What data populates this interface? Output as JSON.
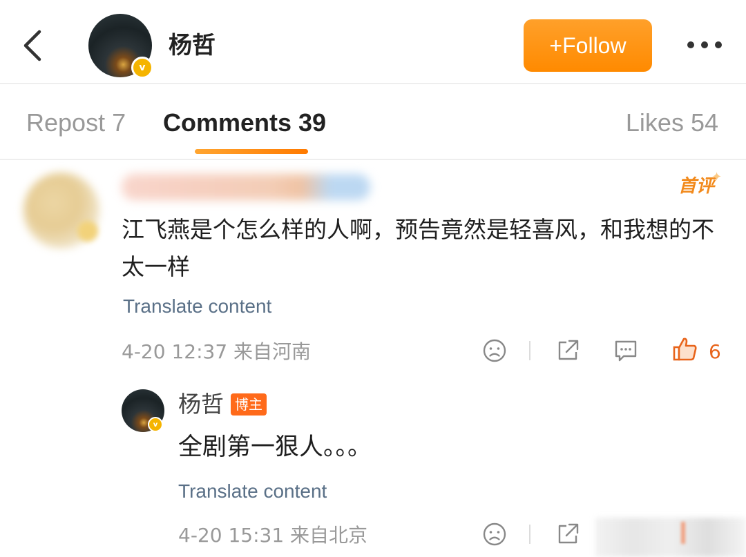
{
  "header": {
    "author_name": "杨哲",
    "follow_label": "+Follow",
    "verified_mark": "v"
  },
  "tabs": {
    "repost": "Repost 7",
    "comments": "Comments 39",
    "likes": "Likes 54"
  },
  "comment": {
    "first_badge": "首评",
    "text": "江飞燕是个怎么样的人啊，预告竟然是轻喜风，和我想的不太一样",
    "translate": "Translate content",
    "meta": "4-20 12:37  来自河南",
    "like_count": "6"
  },
  "reply": {
    "name": "杨哲",
    "tag": "博主",
    "text": "全剧第一狠人。。。",
    "translate": "Translate content",
    "meta": "4-20 15:31  来自北京"
  },
  "colors": {
    "accent": "#ff8a00",
    "like": "#e8641b",
    "link": "#5a7087",
    "verified": "#f5b400"
  }
}
